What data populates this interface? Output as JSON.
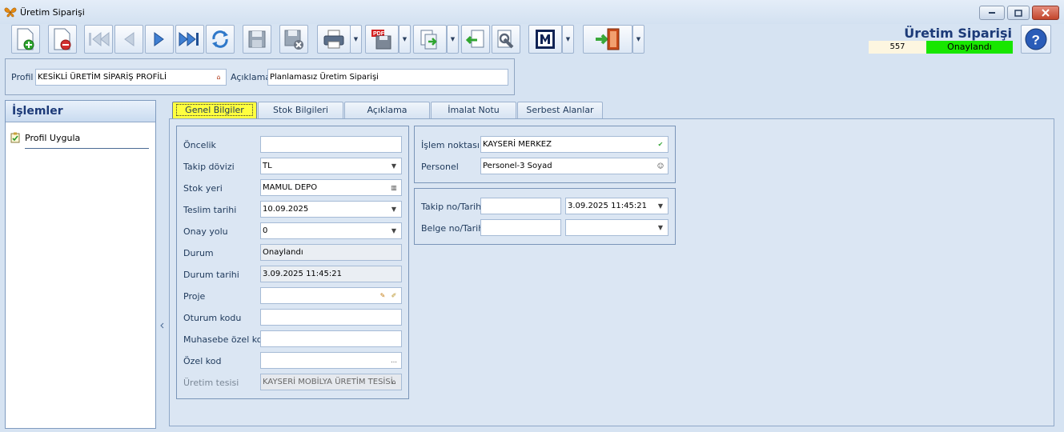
{
  "window": {
    "title": "Üretim Siparişi"
  },
  "header": {
    "doc_title": "Üretim Siparişi",
    "doc_no": "557",
    "doc_status": "Onaylandı",
    "status_color": "#18e600"
  },
  "profile": {
    "profile_label": "Profil",
    "profile_value": "KESİKLİ ÜRETİM SİPARİŞ PROFİLİ",
    "desc_label": "Açıklama",
    "desc_value": "Planlamasız Üretim Siparişi"
  },
  "left_panel": {
    "title": "İşlemler",
    "items": [
      {
        "label": "Profil Uygula"
      }
    ]
  },
  "tabs": [
    {
      "label": "Genel Bilgiler",
      "active": true
    },
    {
      "label": "Stok Bilgileri"
    },
    {
      "label": "Açıklama"
    },
    {
      "label": "İmalat Notu"
    },
    {
      "label": "Serbest Alanlar"
    }
  ],
  "general": {
    "oncelik": {
      "label": "Öncelik",
      "value": ""
    },
    "takip_dovizi": {
      "label": "Takip dövizi",
      "value": "TL"
    },
    "stok_yeri": {
      "label": "Stok yeri",
      "value": "MAMUL DEPO"
    },
    "teslim_tarihi": {
      "label": "Teslim tarihi",
      "value": "10.09.2025"
    },
    "onay_yolu": {
      "label": "Onay yolu",
      "value": "0"
    },
    "durum": {
      "label": "Durum",
      "value": "Onaylandı"
    },
    "durum_tarihi": {
      "label": "Durum tarihi",
      "value": "3.09.2025 11:45:21"
    },
    "proje": {
      "label": "Proje",
      "value": ""
    },
    "oturum_kodu": {
      "label": "Oturum kodu",
      "value": ""
    },
    "muhasebe_ozel_kod": {
      "label": "Muhasebe özel kod",
      "value": ""
    },
    "ozel_kod": {
      "label": "Özel kod",
      "value": ""
    },
    "uretim_tesisi": {
      "label": "Üretim tesisi",
      "value": "KAYSERİ MOBİLYA ÜRETİM TESİSİ"
    }
  },
  "location": {
    "islem_noktasi": {
      "label": "İşlem noktası",
      "value": "KAYSERİ MERKEZ"
    },
    "personel": {
      "label": "Personel",
      "value": "Personel-3 Soyad"
    }
  },
  "tracking": {
    "takip": {
      "label": "Takip no/Tarih",
      "no": "",
      "date": "3.09.2025 11:45:21"
    },
    "belge": {
      "label": "Belge no/Tarih",
      "no": "",
      "date": ""
    }
  },
  "toolbar_icons": [
    "new-document-icon",
    "delete-document-icon",
    "first-record-icon",
    "previous-record-icon",
    "next-record-icon",
    "last-record-icon",
    "refresh-icon",
    "save-icon",
    "save-close-icon",
    "print-icon",
    "pdf-export-icon",
    "export-icon",
    "import-icon",
    "settings-icon",
    "m-icon",
    "exit-door-icon"
  ]
}
